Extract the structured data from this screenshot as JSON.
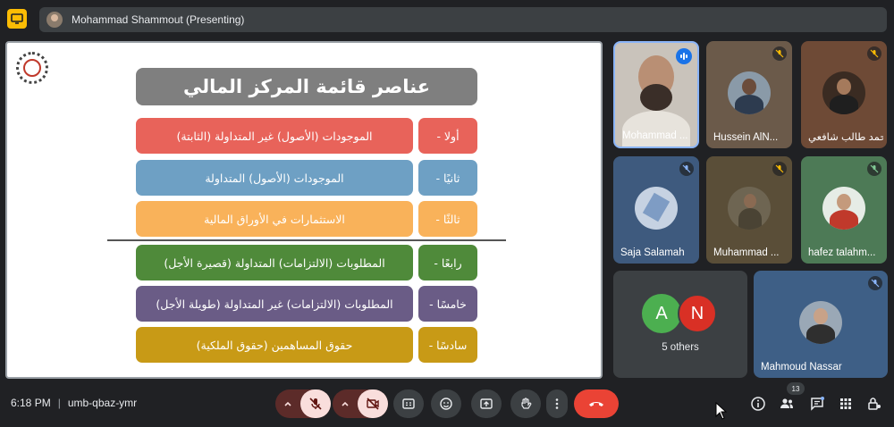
{
  "topbar": {
    "presenter": "Mohammad Shammout (Presenting)"
  },
  "slide": {
    "title": "عناصر قائمة المركز المالي",
    "rows": [
      {
        "num": "أولا -",
        "text": "الموجودات (الأصول) غير المتداولة (الثابتة)",
        "num_color": "#e8635a",
        "text_color": "#e8635a"
      },
      {
        "num": "ثانيًا -",
        "text": "الموجودات (الأصول) المتداولة",
        "num_color": "#6ea0c4",
        "text_color": "#6ea0c4"
      },
      {
        "num": "ثالثًا -",
        "text": "الاستثمارات في الأوراق المالية",
        "num_color": "#f9b25a",
        "text_color": "#f9b25a"
      },
      {
        "num": "رابعًا -",
        "text": "المطلوبات (الالتزامات) المتداولة (قصيرة الأجل)",
        "num_color": "#4f8a3a",
        "text_color": "#4f8a3a"
      },
      {
        "num": "خامسًا -",
        "text": "المطلوبات (الالتزامات) غير المتداولة (طويلة الأجل)",
        "num_color": "#6a5c86",
        "text_color": "#6a5c86"
      },
      {
        "num": "سادسًا -",
        "text": "حقوق المساهمين (حقوق الملكية)",
        "num_color": "#c89a16",
        "text_color": "#c89a16"
      }
    ]
  },
  "participants": [
    {
      "name": "Mohammad ...",
      "status": "speaking"
    },
    {
      "name": "Hussein AlN...",
      "status": "muted"
    },
    {
      "name": "محمد طالب شافعي...",
      "status": "muted"
    },
    {
      "name": "Saja Salamah",
      "status": "muted"
    },
    {
      "name": "Muhammad ...",
      "status": "muted"
    },
    {
      "name": "hafez talahm...",
      "status": "muted"
    },
    {
      "name": "Mahmoud Nassar",
      "status": "muted"
    }
  ],
  "others": {
    "initial_a": "A",
    "initial_n": "N",
    "label": "5 others"
  },
  "bottombar": {
    "time": "6:18 PM",
    "separator": "|",
    "meeting_code": "umb-qbaz-ymr",
    "people_count": "13"
  },
  "colors": {
    "background": "#202124",
    "end_call": "#ea4335",
    "accent_blue": "#1a73e8"
  }
}
